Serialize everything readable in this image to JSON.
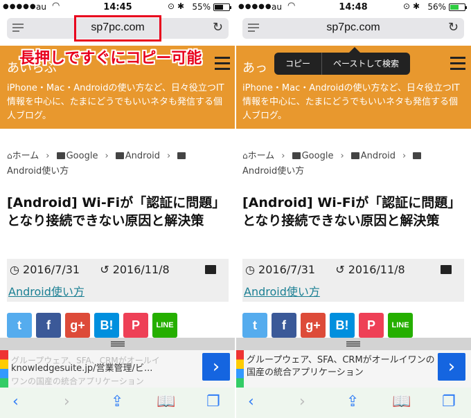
{
  "left": {
    "status": {
      "carrier": "au",
      "time": "14:45",
      "battery": "55%",
      "battery_level": 0.55
    },
    "url": "sp7pc.com",
    "header": {
      "title": "あいらぶ",
      "description": "iPhone・Mac・Androidの使い方など、日々役立つIT情報を中心に、たまにどうでもいいネタも発信する個人ブログ。"
    },
    "annotation": "長押しですぐにコピー可能",
    "breadcrumb": [
      "ホーム",
      "Google",
      "Android",
      "Android使い方"
    ],
    "post_title": "[Android] Wi-Fiが「認証に問題」となり接続できない原因と解決策",
    "published": "2016/7/31",
    "updated": "2016/11/8",
    "category": "Android使い方",
    "share": [
      "t",
      "f",
      "g+",
      "B!",
      "P",
      "LINE"
    ],
    "ad": {
      "faint": "グループウェア、SFA、CRMがオールイ",
      "text": "knowledgesuite.jp/営業管理/ビ...",
      "faint2": "ワンの国産の統合アプリケーション"
    }
  },
  "right": {
    "status": {
      "carrier": "au",
      "time": "14:48",
      "battery": "56%",
      "battery_level": 0.56
    },
    "url": "sp7pc.com",
    "header": {
      "title": "あっ",
      "description": "iPhone・Mac・Androidの使い方など、日々役立つIT情報を中心に、たまにどうでもいいネタも発信する個人ブログ。"
    },
    "popup": {
      "copy": "コピー",
      "paste_search": "ペーストして検索"
    },
    "breadcrumb": [
      "ホーム",
      "Google",
      "Android",
      "Android使い方"
    ],
    "post_title": "[Android] Wi-Fiが「認証に問題」となり接続できない原因と解決策",
    "published": "2016/7/31",
    "updated": "2016/11/8",
    "category": "Android使い方",
    "share": [
      "t",
      "f",
      "g+",
      "B!",
      "P",
      "LINE"
    ],
    "ad": {
      "text": "グループウェア、SFA、CRMがオールイワンの国産の統合アプリケーション"
    }
  },
  "colors": {
    "header_bg": "#e8982e",
    "annotation_red": "#e8001c",
    "link": "#1a7f93",
    "twitter": "#55acee",
    "facebook": "#3b5998",
    "googleplus": "#dd4b39",
    "hatena": "#008fde",
    "pocket": "#ee4056",
    "line": "#25af00",
    "ad_button": "#1565e0",
    "toolbar_icon": "#2f7cf6"
  },
  "toolbar_icons": [
    "back-icon",
    "forward-icon",
    "share-icon",
    "bookmarks-icon",
    "tabs-icon"
  ]
}
